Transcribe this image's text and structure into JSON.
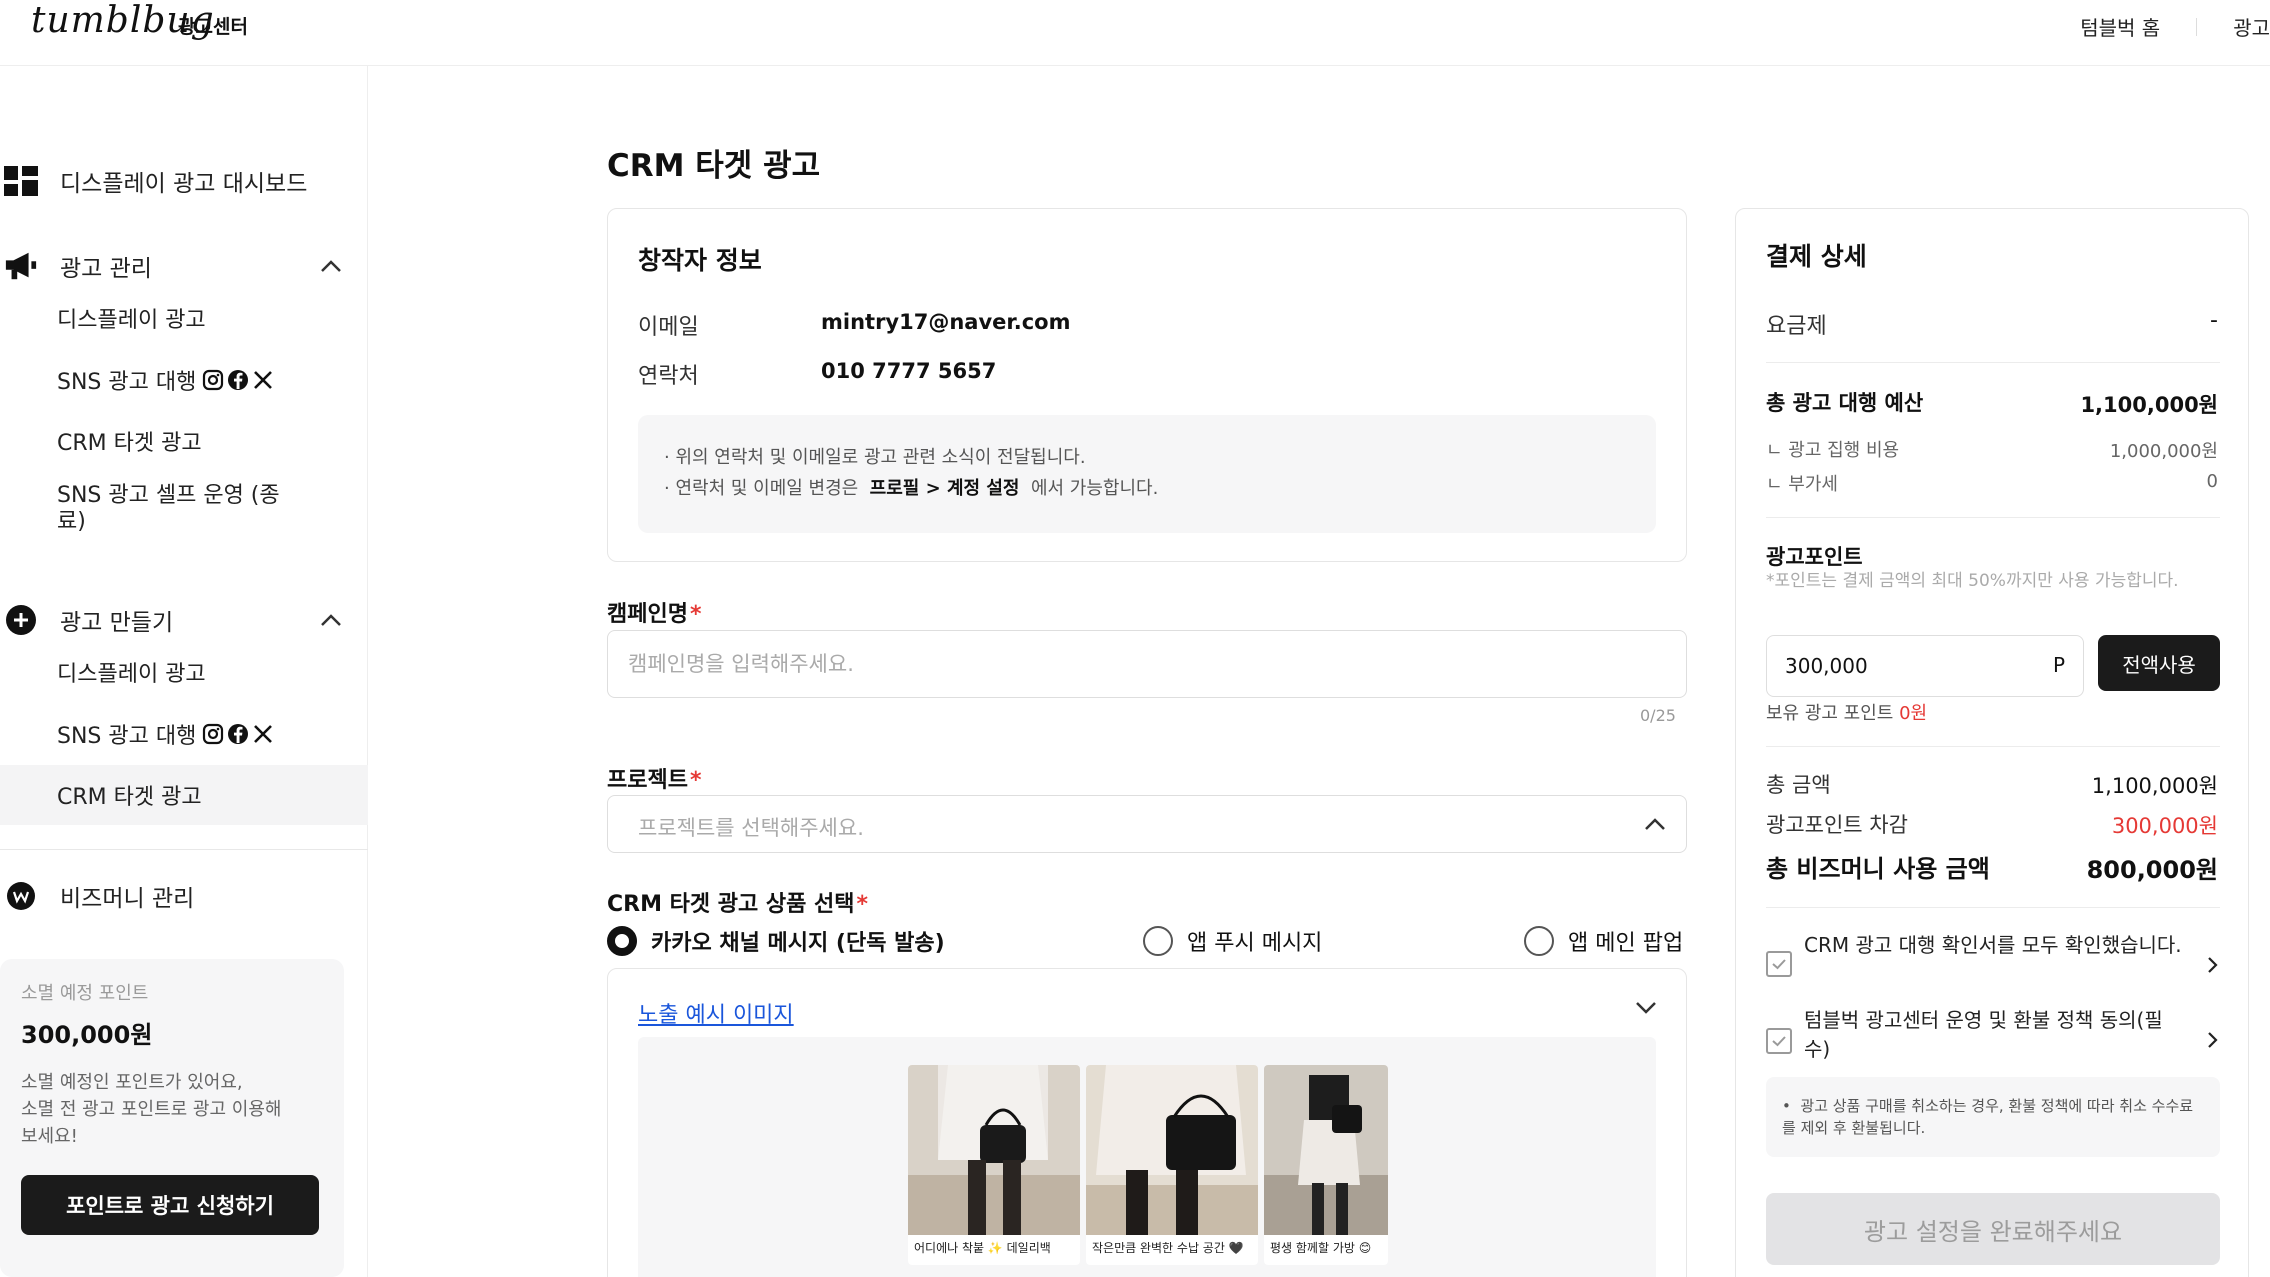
{
  "header": {
    "logo": "tumblbug",
    "logo_sub": "광고센터",
    "nav": [
      "텀블벅 홈",
      "광고"
    ]
  },
  "sidebar": {
    "dashboard": "디스플레이 광고 대시보드",
    "manage": {
      "label": "광고 관리",
      "items": [
        "디스플레이 광고",
        "SNS 광고 대행",
        "CRM 타겟 광고",
        "SNS 광고 셀프 운영 (종료)"
      ]
    },
    "create": {
      "label": "광고 만들기",
      "items": [
        "디스플레이 광고",
        "SNS 광고 대행",
        "CRM 타겟 광고"
      ]
    },
    "bizmoney": "비즈머니 관리",
    "point_card": {
      "label": "소멸 예정 포인트",
      "amount": "300,000원",
      "desc": [
        "소멸 예정인 포인트가 있어요,",
        "소멸 전 광고 포인트로 광고 이용해",
        "보세요!"
      ],
      "button": "포인트로 광고 신청하기"
    }
  },
  "main": {
    "title": "CRM 타겟 광고",
    "creator": {
      "title": "창작자 정보",
      "email_label": "이메일",
      "email": "mintry17@naver.com",
      "phone_label": "연락처",
      "phone": "010 7777 5657",
      "notice1": "위의 연락처 및 이메일로 광고 관련 소식이 전달됩니다.",
      "notice2_pre": "연락처 및 이메일 변경은",
      "notice2_bold": "프로필 > 계정 설정",
      "notice2_post": "에서 가능합니다."
    },
    "campaign": {
      "label": "캠페인명",
      "placeholder": "캠페인명을 입력해주세요.",
      "counter": "0/25"
    },
    "project": {
      "label": "프로젝트",
      "placeholder": "프로젝트를 선택해주세요."
    },
    "product": {
      "label": "CRM 타겟 광고 상품 선택",
      "options": [
        "카카오 채널 메시지 (단독 발송)",
        "앱 푸시 메시지",
        "앱 메인 팝업"
      ],
      "selected": "카카오 채널 메시지 (단독 발송)"
    },
    "preview": {
      "link": "노출 예시 이미지",
      "captions": [
        "어디에나 착붙 ✨ 데일리백",
        "작은만큼 완벽한 수납 공간 🖤",
        "평생 함께할 가방 😊"
      ]
    }
  },
  "payment": {
    "title": "결제 상세",
    "plan_label": "요금제",
    "plan_value": "-",
    "budget_label": "총 광고 대행 예산",
    "budget_value": "1,100,000원",
    "exec_label": "ㄴ 광고 집행 비용",
    "exec_value": "1,000,000원",
    "vat_label": "ㄴ 부가세",
    "vat_value": "0",
    "points_label": "광고포인트",
    "points_hint": "*포인트는 결제 금액의 최대 50%까지만 사용 가능합니다.",
    "points_input": "300,000",
    "points_unit": "P",
    "use_all": "전액사용",
    "owned_label": "보유 광고 포인트",
    "owned_value": "0원",
    "total_label": "총 금액",
    "total_value": "1,100,000원",
    "deduct_label": "광고포인트 차감",
    "deduct_value": "300,000원",
    "final_label": "총 비즈머니 사용 금액",
    "final_value": "800,000원",
    "check1": "CRM 광고 대행 확인서를 모두 확인했습니다.",
    "check2": "텀블벅 광고센터 운영 및 환불 정책 동의(필수)",
    "refund_note": "광고 상품 구매를 취소하는 경우, 환불 정책에 따라 취소 수수료를 제외 후 환불됩니다.",
    "submit": "광고 설정을 완료해주세요"
  }
}
